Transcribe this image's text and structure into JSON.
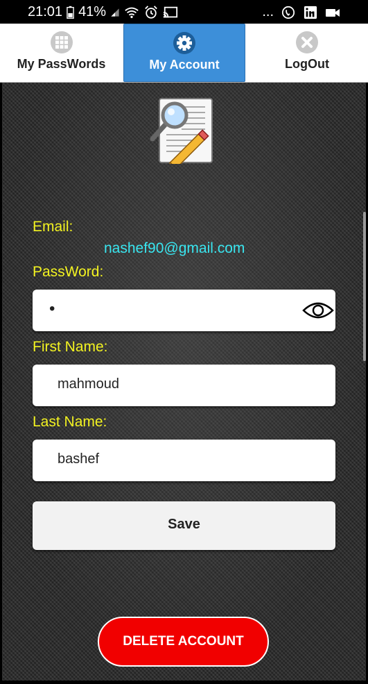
{
  "status_bar": {
    "time": "21:01",
    "battery": "41%",
    "icons": [
      "battery-icon",
      "signal-icon",
      "wifi-icon",
      "alarm-icon",
      "cast-icon",
      "more-icon",
      "call-icon",
      "linkedin-icon",
      "video-icon"
    ],
    "overflow": "..."
  },
  "tabs": [
    {
      "label": "My PassWords",
      "icon": "grid-icon",
      "active": false
    },
    {
      "label": "My Account",
      "icon": "gear-icon",
      "active": true
    },
    {
      "label": "LogOut",
      "icon": "close-circle-icon",
      "active": false
    }
  ],
  "form": {
    "email_label": "Email:",
    "email_value": "nashef90@gmail.com",
    "password_label": "PassWord:",
    "password_value": "•",
    "first_name_label": "First Name:",
    "first_name_value": "mahmoud",
    "last_name_label": "Last Name:",
    "last_name_value": "bashef",
    "save_label": "Save",
    "delete_label": "DELETE ACCOUNT"
  },
  "colors": {
    "accent_tab": "#3d8fd9",
    "label_yellow": "#f3f321",
    "email_cyan": "#39e6f0",
    "delete_red": "#f10000"
  }
}
